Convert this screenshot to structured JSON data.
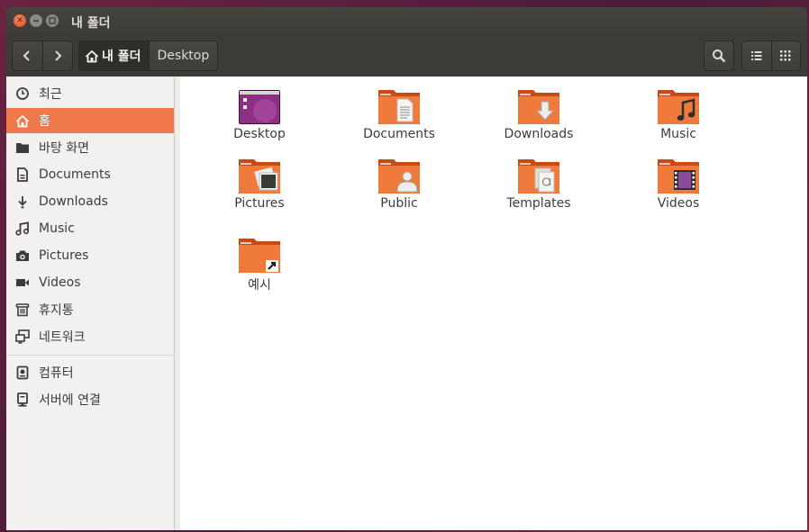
{
  "window": {
    "title": "내 폴더"
  },
  "toolbar": {
    "back_icon": "chevron-left-icon",
    "forward_icon": "chevron-right-icon",
    "path": [
      {
        "label": "내 폴더",
        "icon": "home-icon",
        "active": true
      },
      {
        "label": "Desktop",
        "active": false
      }
    ],
    "search_icon": "search-icon",
    "list_view_icon": "list-view-icon",
    "grid_view_icon": "grid-view-icon"
  },
  "sidebar": {
    "items": [
      {
        "label": "최근",
        "icon": "clock-icon"
      },
      {
        "label": "홈",
        "icon": "home-icon",
        "selected": true
      },
      {
        "label": "바탕 화면",
        "icon": "folder-icon"
      },
      {
        "label": "Documents",
        "icon": "document-icon"
      },
      {
        "label": "Downloads",
        "icon": "download-icon"
      },
      {
        "label": "Music",
        "icon": "music-icon"
      },
      {
        "label": "Pictures",
        "icon": "camera-icon"
      },
      {
        "label": "Videos",
        "icon": "video-icon"
      },
      {
        "label": "휴지통",
        "icon": "trash-icon"
      },
      {
        "label": "네트워크",
        "icon": "network-icon"
      },
      {
        "label": "컴퓨터",
        "icon": "drive-icon"
      },
      {
        "label": "서버에 연결",
        "icon": "server-icon"
      }
    ]
  },
  "files": [
    {
      "name": "Desktop",
      "icon": "desktop-folder-icon"
    },
    {
      "name": "Documents",
      "icon": "documents-folder-icon"
    },
    {
      "name": "Downloads",
      "icon": "downloads-folder-icon"
    },
    {
      "name": "Music",
      "icon": "music-folder-icon"
    },
    {
      "name": "Pictures",
      "icon": "pictures-folder-icon"
    },
    {
      "name": "Public",
      "icon": "public-folder-icon"
    },
    {
      "name": "Templates",
      "icon": "templates-folder-icon"
    },
    {
      "name": "Videos",
      "icon": "videos-folder-icon"
    },
    {
      "name": "예시",
      "icon": "examples-folder-icon"
    }
  ],
  "colors": {
    "accent": "#f0784a",
    "folder": "#e8642a",
    "titlebar": "#3c3b37"
  }
}
